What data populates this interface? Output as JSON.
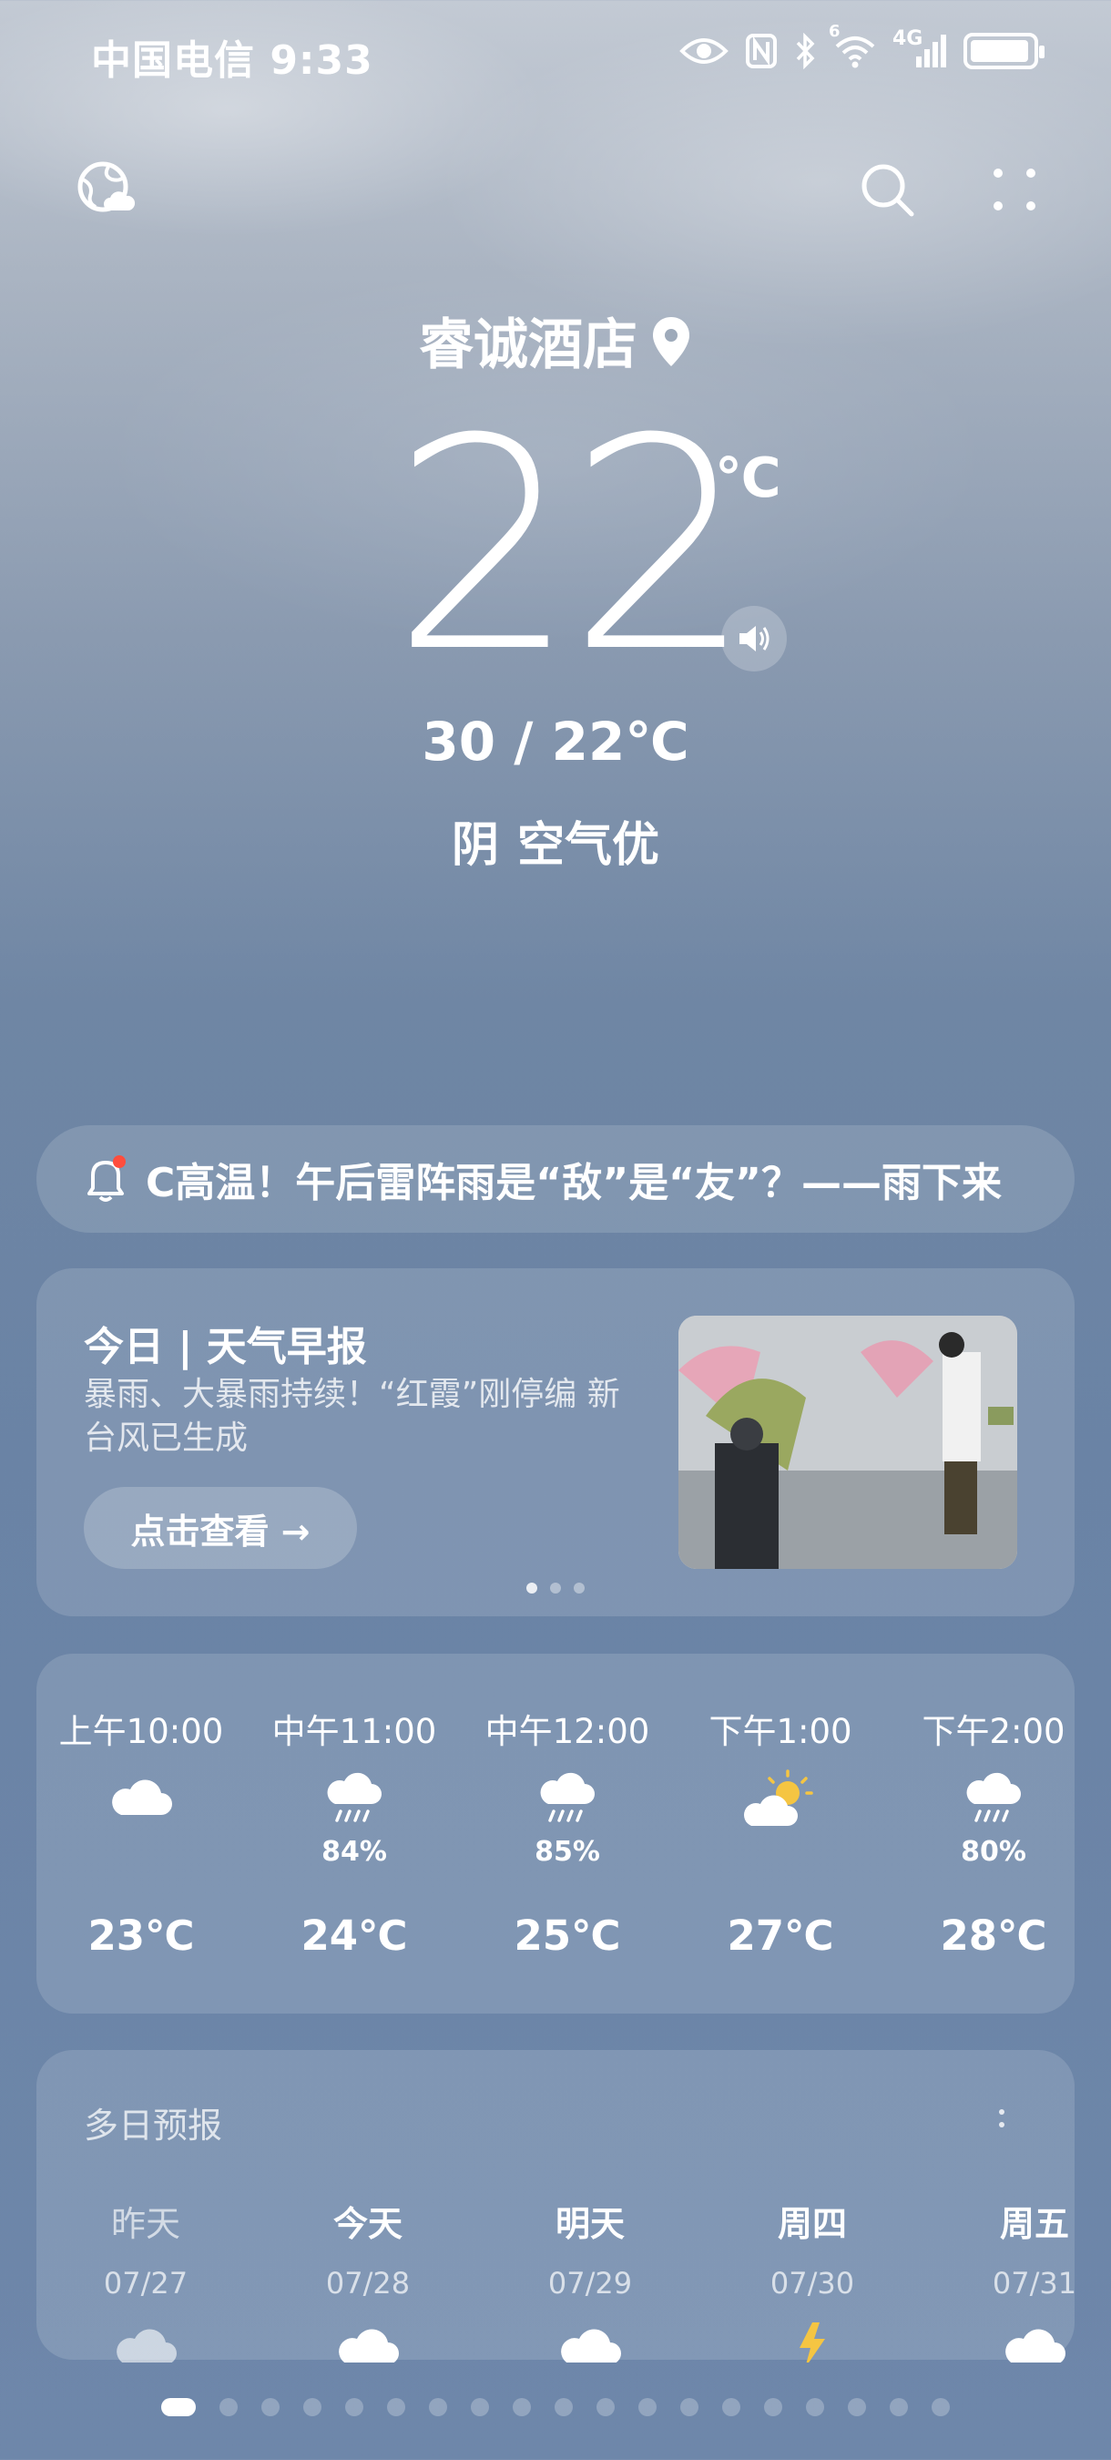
{
  "status_bar": {
    "carrier_time": "中国电信 9:33",
    "network": "4G",
    "wifi_badge": "6",
    "battery_level_percent": 95
  },
  "header": {
    "location": "睿诚酒店",
    "temperature": "22",
    "unit": "℃",
    "range": "30 / 22℃",
    "condition": "阴",
    "air_quality": "空气优"
  },
  "alert": {
    "text": "C高温！午后雷阵雨是“敌”是“友”？——雨下来"
  },
  "news": {
    "title": "今日 | 天气早报",
    "subtitle": "暴雨、大暴雨持续！“红霞”刚停编 新台风已生成",
    "button": "点击查看 →"
  },
  "hourly": [
    {
      "time": "上午10:00",
      "icon": "cloudy-icon",
      "precip": "",
      "temp": "23℃"
    },
    {
      "time": "中午11:00",
      "icon": "rain-icon",
      "precip": "84%",
      "temp": "24℃"
    },
    {
      "time": "中午12:00",
      "icon": "rain-icon",
      "precip": "85%",
      "temp": "25℃"
    },
    {
      "time": "下午1:00",
      "icon": "partly-sunny-icon",
      "precip": "",
      "temp": "27℃"
    },
    {
      "time": "下午2:00",
      "icon": "rain-icon",
      "precip": "80%",
      "temp": "28℃"
    }
  ],
  "multi_day": {
    "title": "多日预报",
    "days": [
      {
        "label": "昨天",
        "date": "07/27",
        "icon": "cloudy-icon"
      },
      {
        "label": "今天",
        "date": "07/28",
        "icon": "cloudy-icon"
      },
      {
        "label": "明天",
        "date": "07/29",
        "icon": "cloudy-icon"
      },
      {
        "label": "周四",
        "date": "07/30",
        "icon": "thunder-icon"
      },
      {
        "label": "周五",
        "date": "07/31",
        "icon": "cloudy-icon"
      }
    ]
  },
  "pager": {
    "count": 19,
    "active": 0
  },
  "colors": {
    "accent": "#ffffff",
    "alert_dot": "#ff4d3d",
    "sun": "#f5c542"
  }
}
